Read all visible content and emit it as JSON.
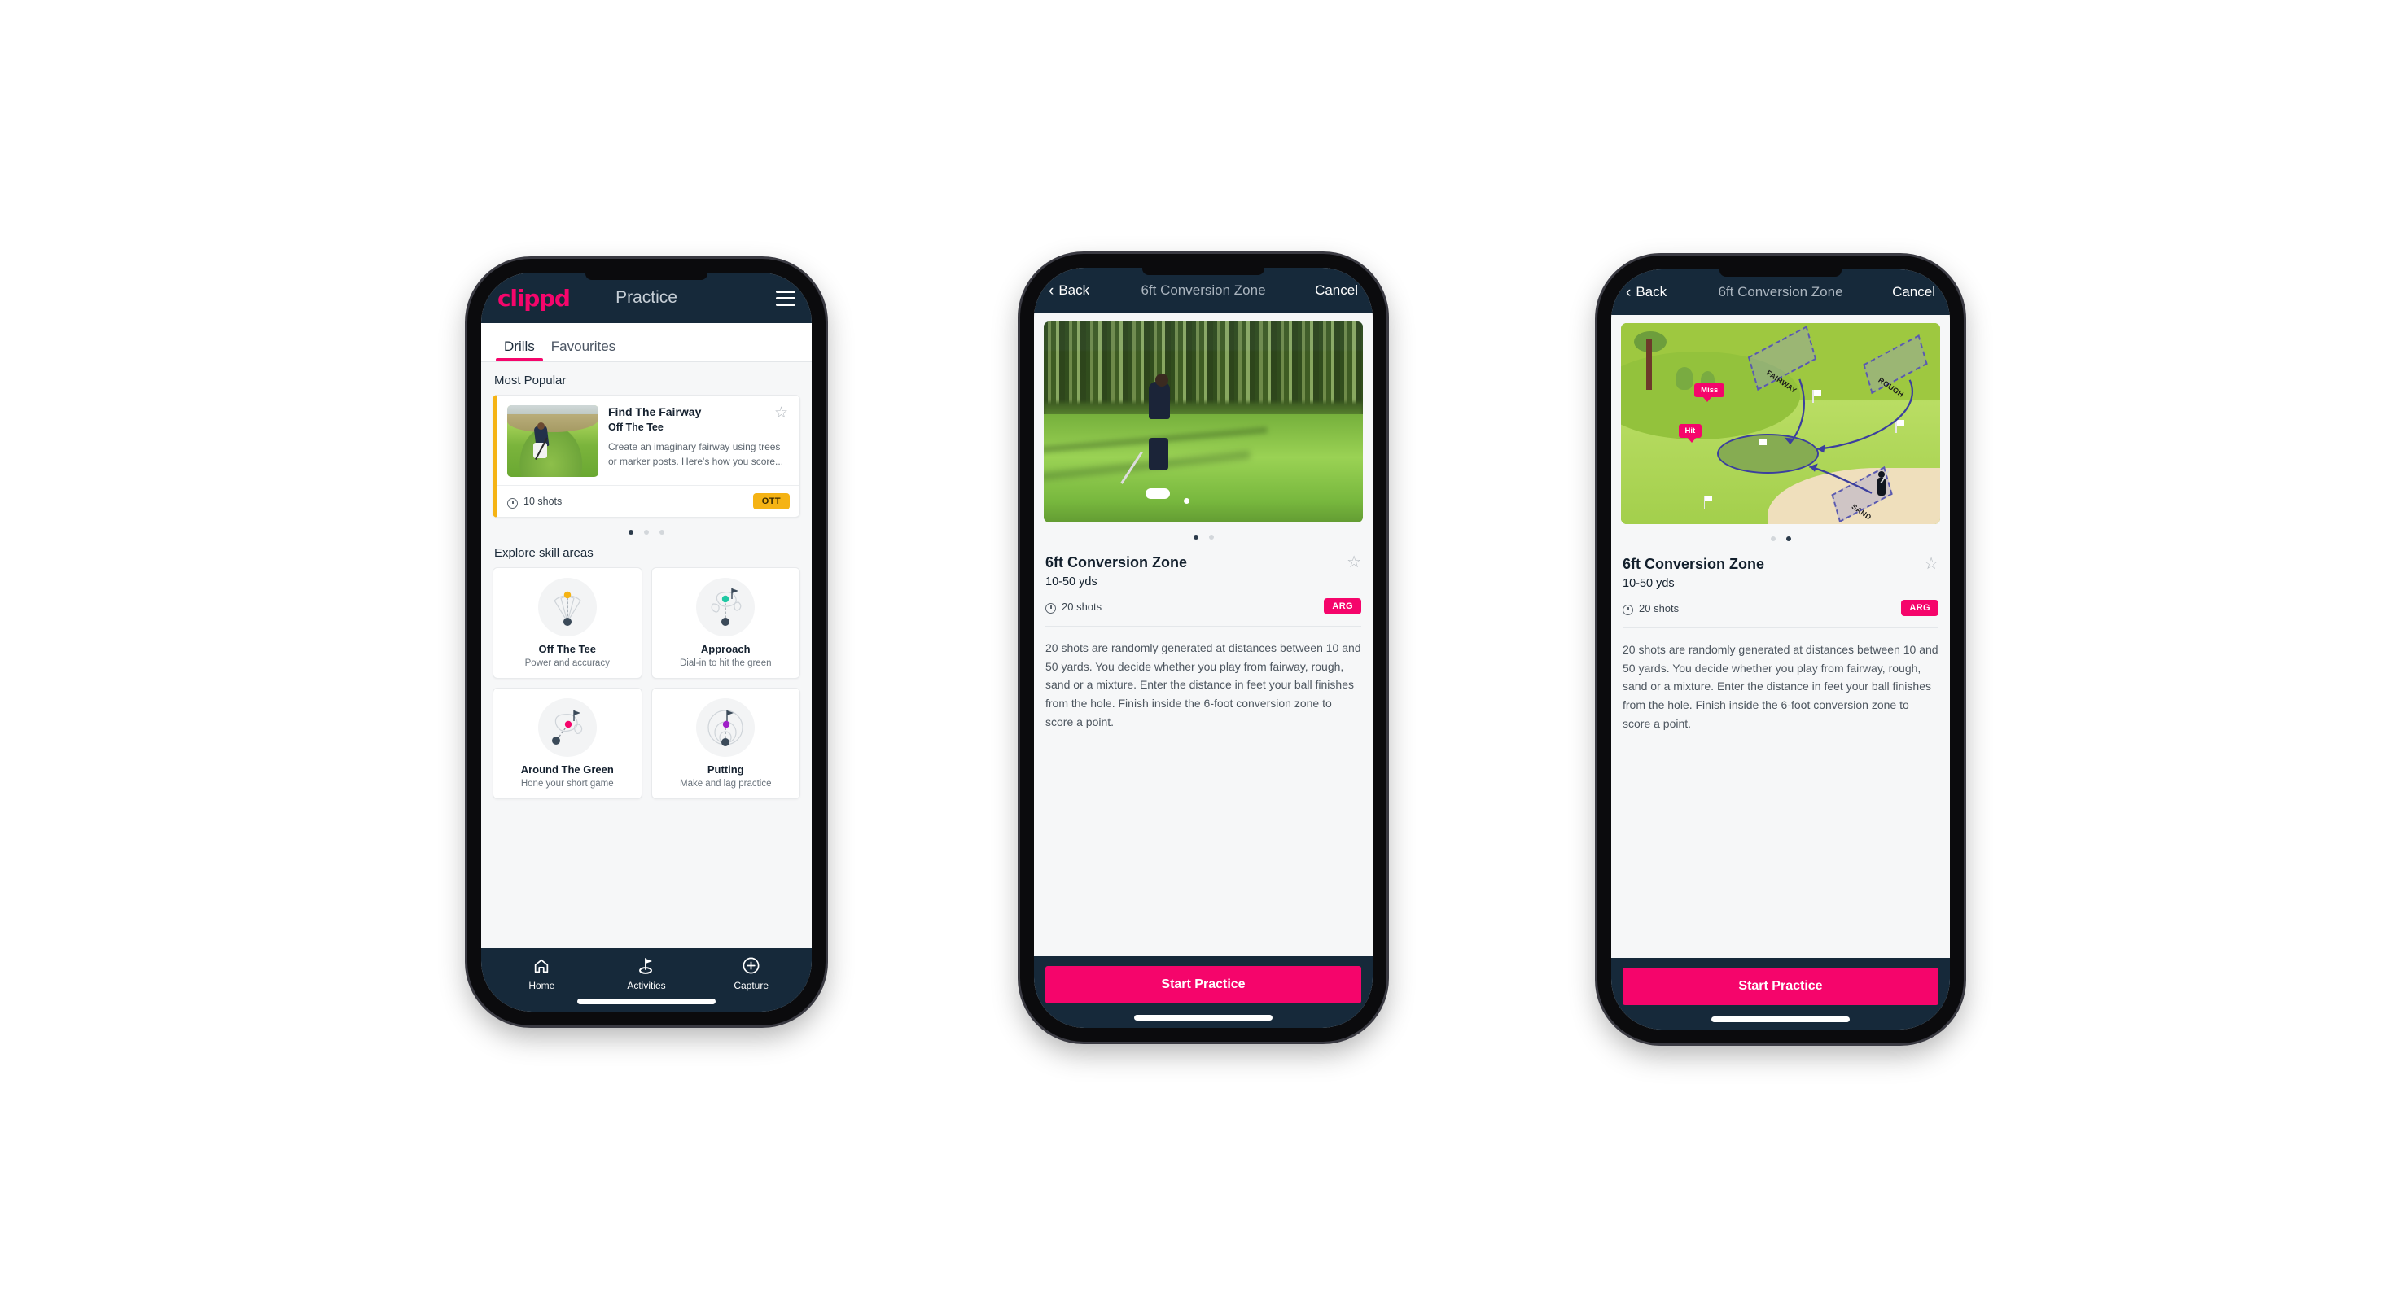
{
  "colors": {
    "brand_pink": "#f5056b",
    "navy": "#16293a",
    "ott_yellow": "#f5b314",
    "teal_accent": "#3ddbb7",
    "page_bg": "#ffffff",
    "screen_bg": "#f6f7f8"
  },
  "phone1": {
    "header": {
      "logo": "clippd",
      "title": "Practice",
      "menu_icon": "hamburger-menu-icon"
    },
    "tabs": [
      {
        "label": "Drills",
        "active": true
      },
      {
        "label": "Favourites",
        "active": false
      }
    ],
    "most_popular": {
      "section_label": "Most Popular",
      "card": {
        "title": "Find The Fairway",
        "subtitle": "Off The Tee",
        "description": "Create an imaginary fairway using trees or marker posts. Here's how you score...",
        "shots": "10 shots",
        "badge": "OTT",
        "favourite_icon": "star-outline-icon",
        "shots_icon": "clock-icon"
      },
      "dots": [
        {
          "active": true
        },
        {
          "active": false
        },
        {
          "active": false
        }
      ]
    },
    "skill_areas": {
      "section_label": "Explore skill areas",
      "items": [
        {
          "name": "Off The Tee",
          "desc": "Power and accuracy",
          "icon": "tee-shot-dispersion-icon",
          "accent": "#f5b314"
        },
        {
          "name": "Approach",
          "desc": "Dial-in to hit the green",
          "icon": "approach-green-icon",
          "accent": "#1fc8a3"
        },
        {
          "name": "Around The Green",
          "desc": "Hone your short game",
          "icon": "chip-around-green-icon",
          "accent": "#f5056b"
        },
        {
          "name": "Putting",
          "desc": "Make and lag practice",
          "icon": "putting-rings-icon",
          "accent": "#a020c8"
        }
      ]
    },
    "tabbar": [
      {
        "label": "Home",
        "icon": "home-icon",
        "active": false
      },
      {
        "label": "Activities",
        "icon": "golf-flag-icon",
        "active": true
      },
      {
        "label": "Capture",
        "icon": "plus-circle-icon",
        "active": false
      }
    ]
  },
  "phone2": {
    "nav": {
      "back": "Back",
      "back_icon": "chevron-left-icon",
      "title": "6ft Conversion Zone",
      "cancel": "Cancel"
    },
    "media": {
      "type": "photo",
      "alt": "golfer-chipping-photo",
      "dots": [
        {
          "active": true
        },
        {
          "active": false
        }
      ]
    },
    "detail": {
      "title": "6ft Conversion Zone",
      "subtitle": "10-50 yds",
      "shots": "20 shots",
      "shots_icon": "clock-icon",
      "badge": "ARG",
      "favourite_icon": "star-outline-icon",
      "description": "20 shots are randomly generated at distances between 10 and 50 yards. You decide whether you play from fairway, rough, sand or a mixture. Enter the distance in feet your ball finishes from the hole. Finish inside the 6-foot conversion zone to score a point."
    },
    "cta": "Start Practice"
  },
  "phone3": {
    "nav": {
      "back": "Back",
      "back_icon": "chevron-left-icon",
      "title": "6ft Conversion Zone",
      "cancel": "Cancel"
    },
    "media": {
      "type": "illustration",
      "alt": "golf-hole-diagram-illustration",
      "zone_labels": [
        "FAIRWAY",
        "ROUGH",
        "SAND"
      ],
      "result_tags": [
        "Miss",
        "Hit"
      ],
      "dots": [
        {
          "active": false
        },
        {
          "active": true
        }
      ]
    },
    "detail": {
      "title": "6ft Conversion Zone",
      "subtitle": "10-50 yds",
      "shots": "20 shots",
      "shots_icon": "clock-icon",
      "badge": "ARG",
      "favourite_icon": "star-outline-icon",
      "description": "20 shots are randomly generated at distances between 10 and 50 yards. You decide whether you play from fairway, rough, sand or a mixture. Enter the distance in feet your ball finishes from the hole. Finish inside the 6-foot conversion zone to score a point."
    },
    "cta": "Start Practice"
  }
}
